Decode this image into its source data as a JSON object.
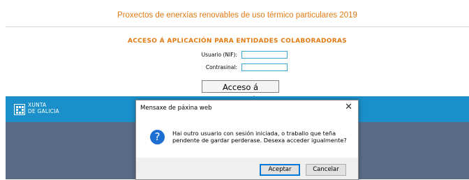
{
  "header": {
    "title": "Proxectos de enerxías renovables de uso térmico particulares 2019"
  },
  "login": {
    "section_title": "ACCESO Á APLICACIÓN PARA ENTIDADES COLABORADORAS",
    "user_label": "Usuario (NIF):",
    "user_value": "",
    "password_label": "Contrasinal:",
    "password_value": "",
    "submit_label": "Acceso á aplicación"
  },
  "footer": {
    "logo_line1": "XUNTA",
    "logo_line2": "DE GALICIA"
  },
  "dialog": {
    "title": "Mensaxe de páxina web",
    "close_glyph": "✕",
    "icon_glyph": "?",
    "message_line1": "Hai outro usuario con sesión iniciada, o traballo que teña",
    "message_line2": "pendente de gardar perderase. Desexa acceder igualmente?",
    "accept_label": "Aceptar",
    "cancel_label": "Cancelar"
  },
  "colors": {
    "accent": "#e07a12",
    "footer": "#1b8fc9",
    "backdrop": "#5a6b86",
    "dialog_icon": "#1d6fd1"
  }
}
